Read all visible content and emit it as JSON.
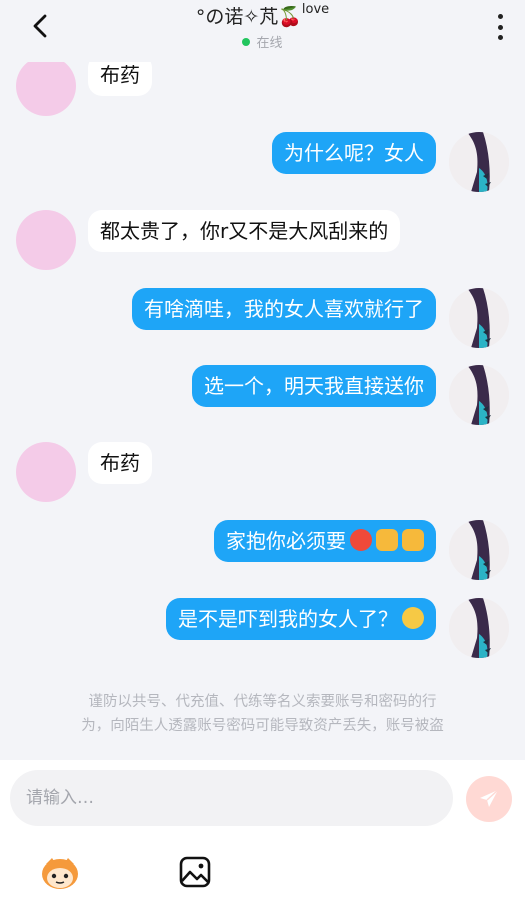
{
  "header": {
    "back_icon": "chevron-left-icon",
    "title": "°の诺✧芃🍒",
    "title_suffix": "love",
    "status": "在线",
    "status_color": "#22c55e",
    "more_icon": "more-vertical-icon"
  },
  "messages": [
    {
      "from": "other",
      "text": "布药"
    },
    {
      "from": "me",
      "text": "为什么呢？女人"
    },
    {
      "from": "other",
      "text": "都太贵了，你r又不是大风刮来的"
    },
    {
      "from": "me",
      "text": "有啥滴哇，我的女人喜欢就行了"
    },
    {
      "from": "me",
      "text": "选一个，明天我直接送你"
    },
    {
      "from": "other",
      "text": "布药"
    },
    {
      "from": "me",
      "text": "家抱你必须要",
      "emojis": [
        "angry-face-emoji",
        "fist-emoji",
        "fist-emoji"
      ]
    },
    {
      "from": "me",
      "text": "是不是吓到我的女人了？",
      "emojis": [
        "crying-face-emoji"
      ]
    }
  ],
  "notice": {
    "line1": "谨防以共号、代充值、代练等名义索要账号和密码的行",
    "line2": "为，向陌生人透露账号密码可能导致资产丢失，账号被盗"
  },
  "composer": {
    "placeholder": "请输入…",
    "send_icon": "send-icon"
  },
  "toolbar": {
    "items": [
      "mascot-icon",
      "image-icon"
    ]
  },
  "colors": {
    "accent": "#1ea5f7",
    "background": "#f3f4f8",
    "send_button": "#ffd9d4",
    "other_avatar": "#f4cbe8"
  }
}
